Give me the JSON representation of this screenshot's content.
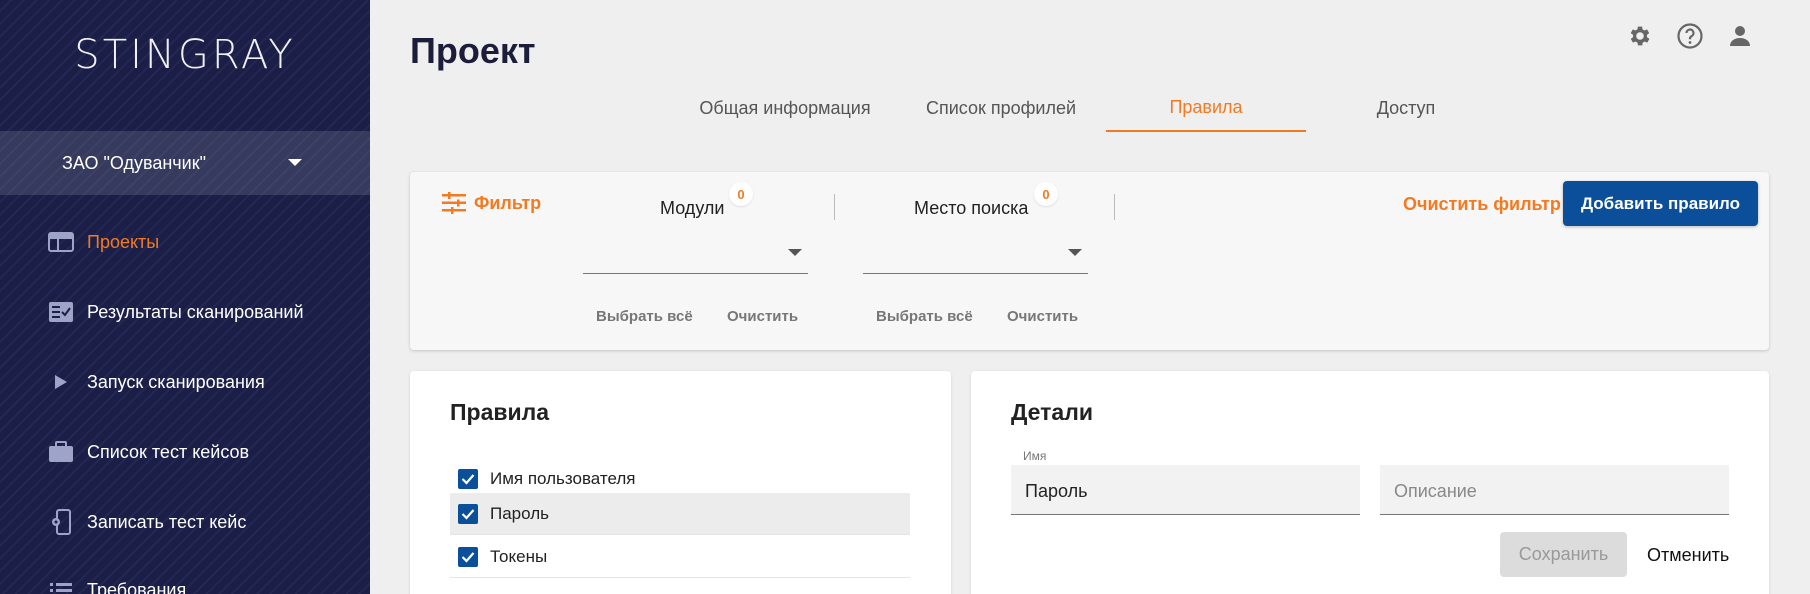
{
  "sidebar": {
    "logo": "STINGRAY",
    "org": "ЗАО \"Одуванчик\"",
    "items": [
      {
        "label": "Проекты",
        "icon": "projects-icon"
      },
      {
        "label": "Результаты сканирований",
        "icon": "scan-results-icon"
      },
      {
        "label": "Запуск сканирования",
        "icon": "play-icon"
      },
      {
        "label": "Список тест кейсов",
        "icon": "briefcase-icon"
      },
      {
        "label": "Записать тест кейс",
        "icon": "phone-record-icon"
      },
      {
        "label": "Требования",
        "icon": "list-icon"
      }
    ]
  },
  "header": {
    "title": "Проект",
    "icons": [
      "gear-icon",
      "help-icon",
      "user-icon"
    ]
  },
  "tabs": [
    {
      "label": "Общая информация"
    },
    {
      "label": "Список профилей"
    },
    {
      "label": "Правила",
      "active": true
    },
    {
      "label": "Доступ"
    }
  ],
  "filter": {
    "label": "Фильтр",
    "modules": {
      "title": "Модули",
      "count": "0",
      "select_all": "Выбрать всё",
      "clear": "Очистить"
    },
    "location": {
      "title": "Место поиска",
      "count": "0",
      "select_all": "Выбрать всё",
      "clear": "Очистить"
    },
    "clear_filter": "Очистить фильтр",
    "add_rule": "Добавить правило"
  },
  "rules": {
    "title": "Правила",
    "items": [
      {
        "label": "Имя пользователя",
        "checked": true
      },
      {
        "label": "Пароль",
        "checked": true,
        "selected": true
      },
      {
        "label": "Токены",
        "checked": true
      }
    ]
  },
  "details": {
    "title": "Детали",
    "name_label": "Имя",
    "name_value": "Пароль",
    "description_placeholder": "Описание",
    "save": "Сохранить",
    "cancel": "Отменить"
  },
  "colors": {
    "accent": "#f47a22",
    "primary": "#0b4f9a",
    "sidebar": "#1b1f47"
  }
}
